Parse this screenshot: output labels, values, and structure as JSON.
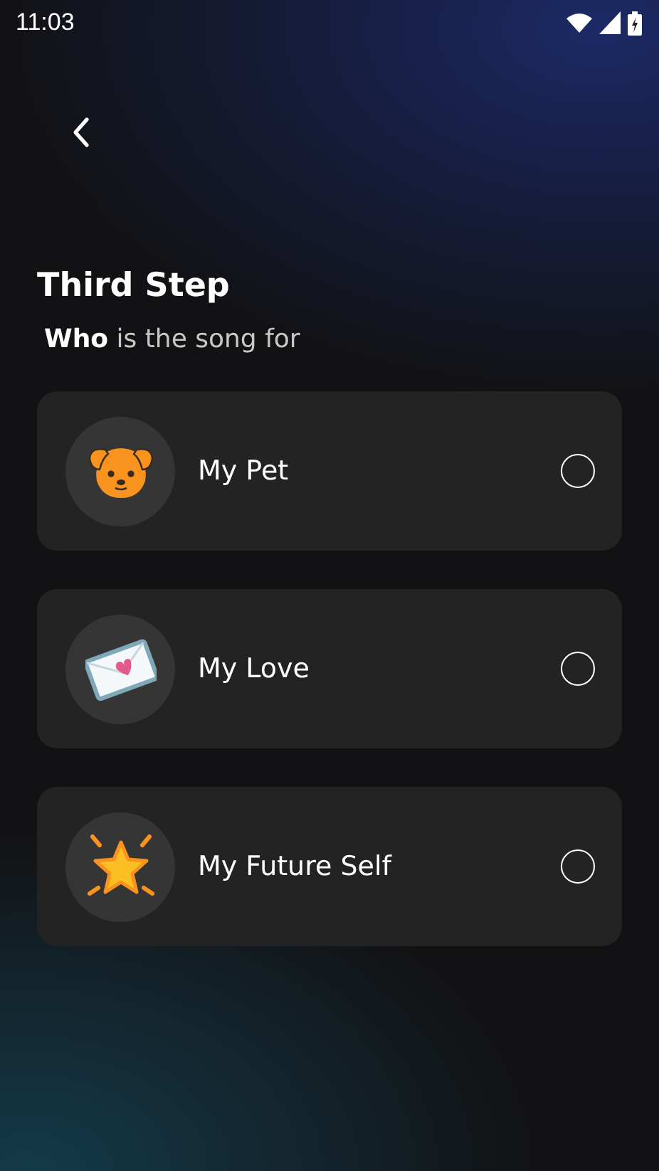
{
  "status_bar": {
    "time": "11:03"
  },
  "title": "Third Step",
  "subtitle": "**Who** is the song for",
  "options": [
    {
      "kind": "dog",
      "label": "My Pet",
      "selected": false
    },
    {
      "kind": "letter",
      "label": "My Love",
      "selected": false
    },
    {
      "kind": "star",
      "label": "My Future Self",
      "selected": false
    }
  ]
}
